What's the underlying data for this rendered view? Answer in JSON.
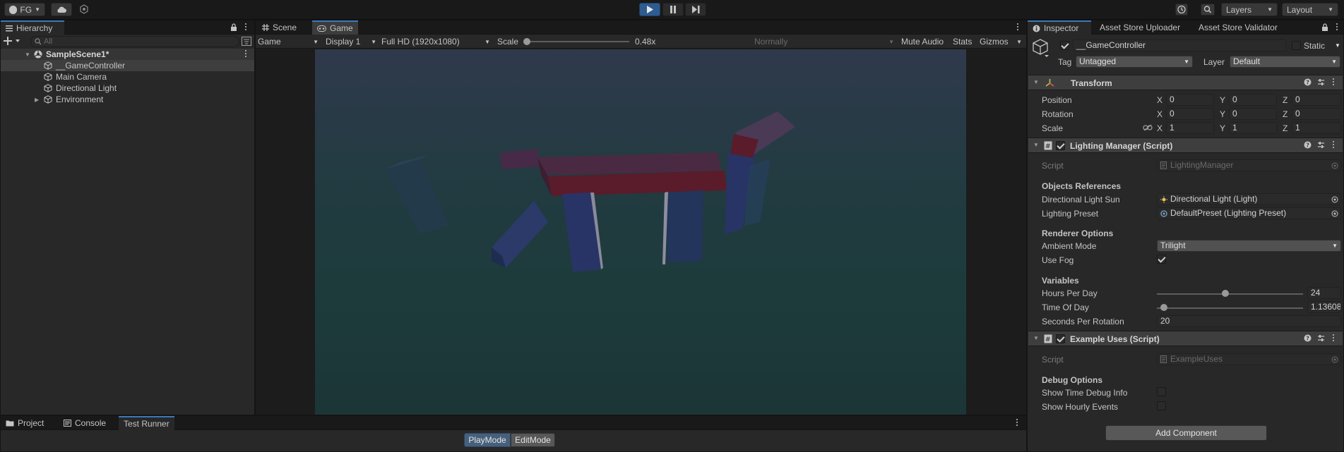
{
  "toolbar": {
    "account_label": "FG",
    "layers_label": "Layers",
    "layout_label": "Layout"
  },
  "hierarchy": {
    "tab_label": "Hierarchy",
    "search_placeholder": "All",
    "scene_name": "SampleScene1*",
    "items": [
      {
        "label": "__GameController"
      },
      {
        "label": "Main Camera"
      },
      {
        "label": "Directional Light"
      },
      {
        "label": "Environment"
      }
    ]
  },
  "view": {
    "tab_scene": "Scene",
    "tab_game": "Game",
    "game_dropdown": "Game",
    "display_dropdown": "Display 1",
    "resolution_dropdown": "Full HD (1920x1080)",
    "scale_label": "Scale",
    "scale_value": "0.48x",
    "normally_dropdown": "Normally",
    "mute_audio": "Mute Audio",
    "stats": "Stats",
    "gizmos": "Gizmos"
  },
  "bottom": {
    "tab_project": "Project",
    "tab_console": "Console",
    "tab_test_runner": "Test Runner",
    "playmode": "PlayMode",
    "editmode": "EditMode"
  },
  "inspector": {
    "tabs": [
      "Inspector",
      "Asset Store Uploader",
      "Asset Store Validator"
    ],
    "object_name": "__GameController",
    "static_label": "Static",
    "tag_label": "Tag",
    "tag_value": "Untagged",
    "layer_label": "Layer",
    "layer_value": "Default",
    "transform": {
      "title": "Transform",
      "position_label": "Position",
      "rotation_label": "Rotation",
      "scale_label": "Scale",
      "x": "X",
      "y": "Y",
      "z": "Z",
      "position": [
        "0",
        "0",
        "0"
      ],
      "rotation": [
        "0",
        "0",
        "0"
      ],
      "scale": [
        "1",
        "1",
        "1"
      ]
    },
    "lighting": {
      "title": "Lighting Manager (Script)",
      "script_label": "Script",
      "script_value": "LightingManager",
      "objects_refs": "Objects References",
      "dir_light_label": "Directional Light Sun",
      "dir_light_value": "Directional Light (Light)",
      "preset_label": "Lighting Preset",
      "preset_value": "DefaultPreset (Lighting Preset)",
      "renderer_options": "Renderer Options",
      "ambient_label": "Ambient Mode",
      "ambient_value": "Trilight",
      "fog_label": "Use Fog",
      "variables": "Variables",
      "hours_label": "Hours Per Day",
      "hours_value": "24",
      "hours_fraction": 0.47,
      "time_label": "Time Of Day",
      "time_value": "1.13608",
      "time_fraction": 0.05,
      "seconds_label": "Seconds Per Rotation",
      "seconds_value": "20"
    },
    "example": {
      "title": "Example Uses (Script)",
      "script_label": "Script",
      "script_value": "ExampleUses",
      "debug_options": "Debug Options",
      "show_time_label": "Show Time Debug Info",
      "show_hourly_label": "Show Hourly Events"
    },
    "add_component": "Add Component"
  },
  "colors": {
    "accent": "#3a79bb",
    "play_active": "#2d5c8f",
    "panel": "#282828"
  }
}
